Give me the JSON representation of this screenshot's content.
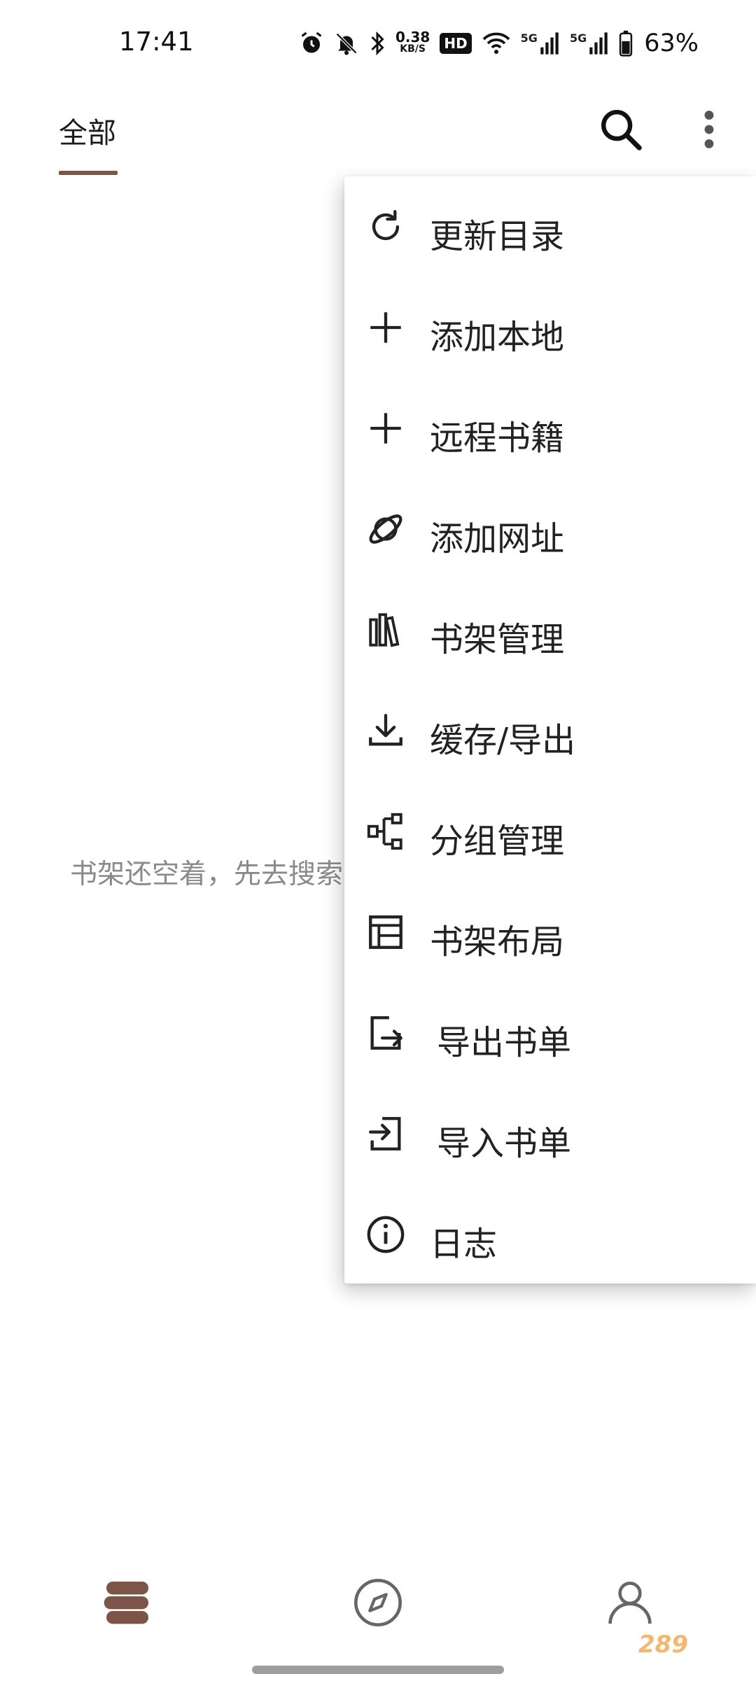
{
  "status_bar": {
    "time": "17:41",
    "speed_value": "0.38",
    "speed_unit": "KB/S",
    "hd_badge": "HD",
    "net1": "5G",
    "net2": "5G",
    "battery": "63%",
    "icons": [
      "alarm-icon",
      "mute-bell-icon",
      "bluetooth-icon",
      "hd-icon",
      "wifi-icon",
      "signal-icon",
      "signal-icon",
      "battery-icon"
    ]
  },
  "header": {
    "tab_label": "全部",
    "accent_color": "#7c5548",
    "actions": [
      "search-icon",
      "more-vert-icon"
    ]
  },
  "shelf": {
    "empty_text": "书架还空着，先去搜索"
  },
  "menu": {
    "items": [
      {
        "label": "更新目录",
        "icon": "refresh-icon"
      },
      {
        "label": "添加本地",
        "icon": "plus-icon"
      },
      {
        "label": "远程书籍",
        "icon": "plus-icon"
      },
      {
        "label": "添加网址",
        "icon": "planet-icon"
      },
      {
        "label": "书架管理",
        "icon": "books-icon"
      },
      {
        "label": "缓存/导出",
        "icon": "download-icon"
      },
      {
        "label": "分组管理",
        "icon": "group-tree-icon"
      },
      {
        "label": "书架布局",
        "icon": "layout-icon"
      },
      {
        "label": "导出书单",
        "icon": "export-icon"
      },
      {
        "label": "导入书单",
        "icon": "import-icon"
      },
      {
        "label": "日志",
        "icon": "info-icon"
      }
    ]
  },
  "bottom_nav": {
    "items": [
      "bookshelf-icon",
      "compass-icon",
      "profile-icon"
    ]
  },
  "watermark": "289"
}
